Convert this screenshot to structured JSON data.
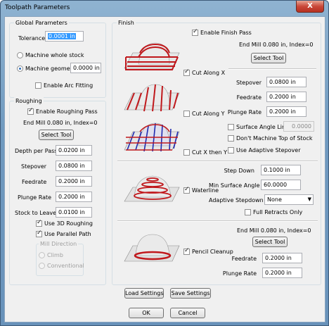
{
  "window": {
    "title": "Toolpath Parameters",
    "close_glyph": "X"
  },
  "global": {
    "title": "Global Parameters",
    "tolerance_label": "Tolerance",
    "tolerance_value": "0.0001 in",
    "machine_whole_stock": "Machine whole stock",
    "machine_geometry": "Machine geometry+",
    "machine_geometry_value": "0.0000 in",
    "arc_fitting": "Enable Arc Fitting"
  },
  "roughing": {
    "title": "Roughing",
    "enable": "Enable Roughing Pass",
    "tool_desc": "End Mill 0.080 in, Index=0",
    "select_tool": "Select Tool",
    "fields": [
      {
        "label": "Depth per Pass",
        "value": "0.0200 in"
      },
      {
        "label": "Stepover",
        "value": "0.0800 in"
      },
      {
        "label": "Feedrate",
        "value": "0.2000 in"
      },
      {
        "label": "Plunge Rate",
        "value": "0.2000 in"
      },
      {
        "label": "Stock to Leave",
        "value": "0.0100 in"
      }
    ],
    "use_3d": "Use 3D Roughing",
    "use_parallel": "Use Parallel Path",
    "mill_direction": "Mill Direction",
    "climb": "Climb",
    "conventional": "Conventional"
  },
  "finish": {
    "title": "Finish",
    "enable": "Enable Finish Pass",
    "tool_desc": "End Mill 0.080 in, Index=0",
    "select_tool": "Select Tool",
    "cut_along_x": "Cut Along X",
    "cut_along_y": "Cut Along Y",
    "cut_x_then_y": "Cut X then Y",
    "stepover_label": "Stepover",
    "stepover_value": "0.0800 in",
    "feedrate_label": "Feedrate",
    "feedrate_value": "0.2000 in",
    "plunge_label": "Plunge Rate",
    "plunge_value": "0.2000 in",
    "surface_angle_limit": "Surface Angle Limit",
    "surface_angle_limit_value": "0.0000",
    "dont_machine_top": "Don't Machine Top of Stock",
    "use_adaptive_stepover": "Use Adaptive Stepover",
    "waterline": "Waterline",
    "step_down_label": "Step Down",
    "step_down_value": "0.1000 in",
    "min_surface_angle_label": "Min Surface Angle",
    "min_surface_angle_value": "60.0000",
    "adaptive_stepdown_label": "Adaptive Stepdown",
    "adaptive_stepdown_value": "None",
    "full_retracts": "Full Retracts Only",
    "pencil_tool_desc": "End Mill 0.080 in, Index=0",
    "pencil_select_tool": "Select Tool",
    "pencil_cleanup": "Pencil Cleanup",
    "pencil_feedrate_label": "Feedrate",
    "pencil_feedrate_value": "0.2000 in",
    "pencil_plunge_label": "Plunge Rate",
    "pencil_plunge_value": "0.2000 in"
  },
  "footer": {
    "load_settings": "Load Settings",
    "save_settings": "Save Settings",
    "ok": "OK",
    "cancel": "Cancel"
  },
  "colors": {
    "toolpath_red": "#c0181c",
    "toolpath_blue": "#1f2ab0",
    "title_bar": "#7ea6c9",
    "selection": "#3399ff"
  }
}
